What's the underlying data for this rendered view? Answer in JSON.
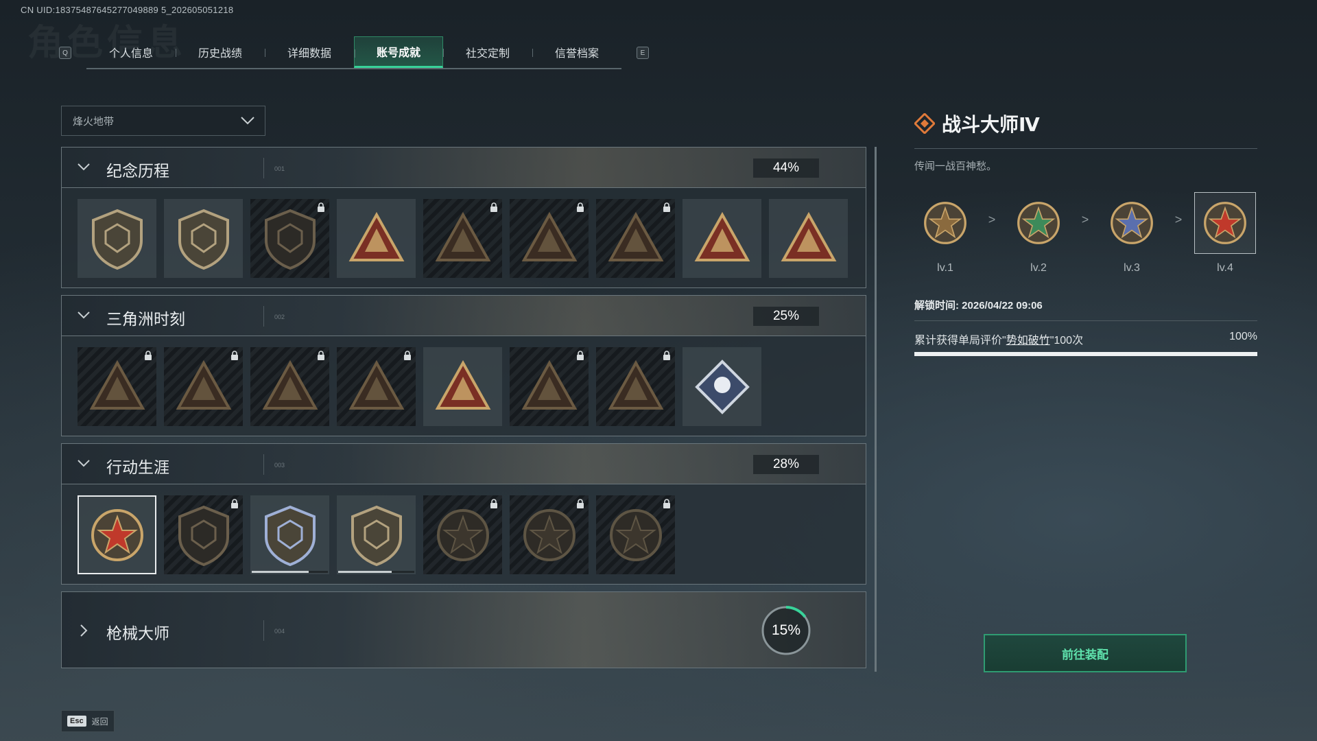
{
  "uid_text": "CN UID:18375487645277049889 5_202605051218",
  "bg_title": "角色信息",
  "tabs": {
    "prev_key": "Q",
    "next_key": "E",
    "items": [
      "个人信息",
      "历史战绩",
      "详细数据",
      "账号成就",
      "社交定制",
      "信誉档案"
    ],
    "active": "账号成就"
  },
  "mode_select": {
    "value": "烽火地带"
  },
  "categories": [
    {
      "name": "纪念历程",
      "code": "001",
      "progress": "44%",
      "expanded": true,
      "badges": [
        {
          "icon": "triangle-emblem-icon",
          "locked": false
        },
        {
          "icon": "helicopter-shield-icon",
          "locked": false
        },
        {
          "icon": "hex-shield-icon",
          "locked": true
        },
        {
          "icon": "flask-triangle-icon",
          "locked": false
        },
        {
          "icon": "soldier-triangle-icon",
          "locked": true
        },
        {
          "icon": "gasmask-triangle-icon",
          "locked": true
        },
        {
          "icon": "crossed-rifles-triangle-icon",
          "locked": true
        },
        {
          "icon": "fist-triangle-icon",
          "locked": false
        },
        {
          "icon": "number-one-triangle-icon",
          "locked": false
        }
      ]
    },
    {
      "name": "三角洲时刻",
      "code": "002",
      "progress": "25%",
      "expanded": true,
      "badges": [
        {
          "icon": "bottle-triangle-icon",
          "locked": true
        },
        {
          "icon": "armor-triangle-icon",
          "locked": true
        },
        {
          "icon": "kneeling-soldier-triangle-icon",
          "locked": true
        },
        {
          "icon": "knot-triangle-icon",
          "locked": true
        },
        {
          "icon": "squad-triangle-icon",
          "locked": false
        },
        {
          "icon": "beast-triangle-icon",
          "locked": true
        },
        {
          "icon": "dragon-triangle-icon",
          "locked": true
        },
        {
          "icon": "diamond-flower-icon",
          "locked": false
        }
      ]
    },
    {
      "name": "行动生涯",
      "code": "003",
      "progress": "28%",
      "expanded": true,
      "badges": [
        {
          "icon": "star-medal-icon",
          "locked": false,
          "selected": true
        },
        {
          "icon": "wing-shield-icon",
          "locked": true
        },
        {
          "icon": "police-shield-icon",
          "locked": false,
          "progress": 0.75
        },
        {
          "icon": "gem-shield-icon",
          "locked": false,
          "progress": 0.7
        },
        {
          "icon": "round-helmet-medal-icon",
          "locked": true
        },
        {
          "icon": "skull-medal-icon",
          "locked": true
        },
        {
          "icon": "eye-medal-icon",
          "locked": true
        }
      ]
    },
    {
      "name": "枪械大师",
      "code": "004",
      "progress": "15%",
      "progress_value": 0.15,
      "expanded": false
    }
  ],
  "detail": {
    "title": "战斗大师Ⅳ",
    "description": "传闻一战百神愁。",
    "levels": [
      {
        "label": "lv.1",
        "icon": "bronze-star-medal-icon"
      },
      {
        "label": "lv.2",
        "icon": "green-star-medal-icon"
      },
      {
        "label": "lv.3",
        "icon": "blue-star-medal-icon"
      },
      {
        "label": "lv.4",
        "icon": "red-star-medal-icon"
      }
    ],
    "level_arrow": ">",
    "unlock_time": "解锁时间: 2026/04/22 09:06",
    "requirement_prefix": "累计获得单局评价\"",
    "requirement_link": "势如破竹",
    "requirement_suffix": "\"100次",
    "requirement_progress": "100%",
    "requirement_value": 1.0
  },
  "equip_button": "前往装配",
  "back": {
    "key": "Esc",
    "label": "返回"
  },
  "colors": {
    "accent": "#38d39a",
    "gold": "#c9a56a",
    "lock": "#d9dee0"
  }
}
